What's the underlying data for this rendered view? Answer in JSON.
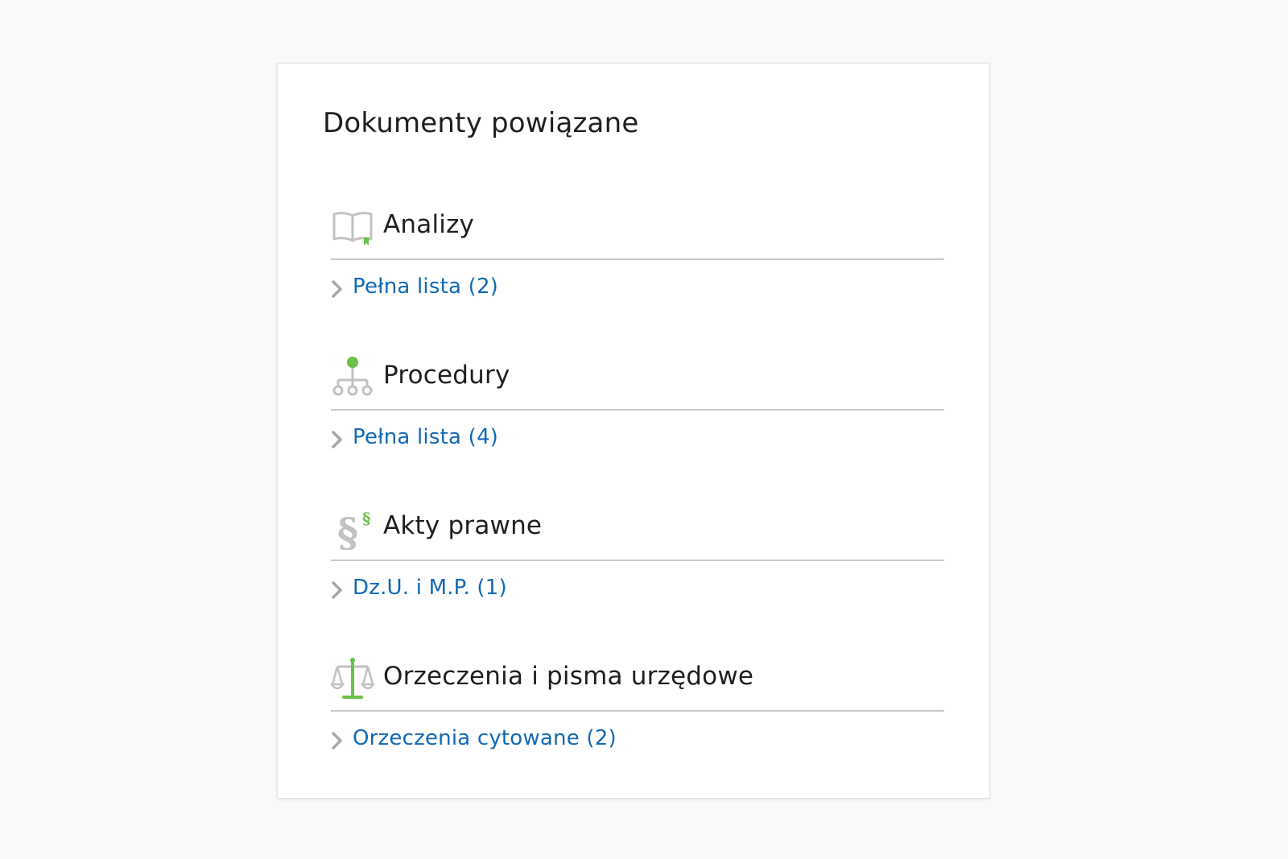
{
  "panel": {
    "title": "Dokumenty powiązane"
  },
  "colors": {
    "accent_green": "#6cc04a",
    "icon_gray": "#c2c2c2",
    "link_blue": "#1168b5",
    "divider": "#c9c9c9"
  },
  "sections": [
    {
      "icon": "book-icon",
      "title": "Analizy",
      "link_label": "Pełna lista (2)"
    },
    {
      "icon": "flowchart-icon",
      "title": "Procedury",
      "link_label": "Pełna lista (4)"
    },
    {
      "icon": "paragraph-icon",
      "title": "Akty prawne",
      "link_label": "Dz.U. i M.P. (1)"
    },
    {
      "icon": "scales-icon",
      "title": "Orzeczenia i pisma urzędowe",
      "link_label": "Orzeczenia cytowane (2)"
    }
  ]
}
